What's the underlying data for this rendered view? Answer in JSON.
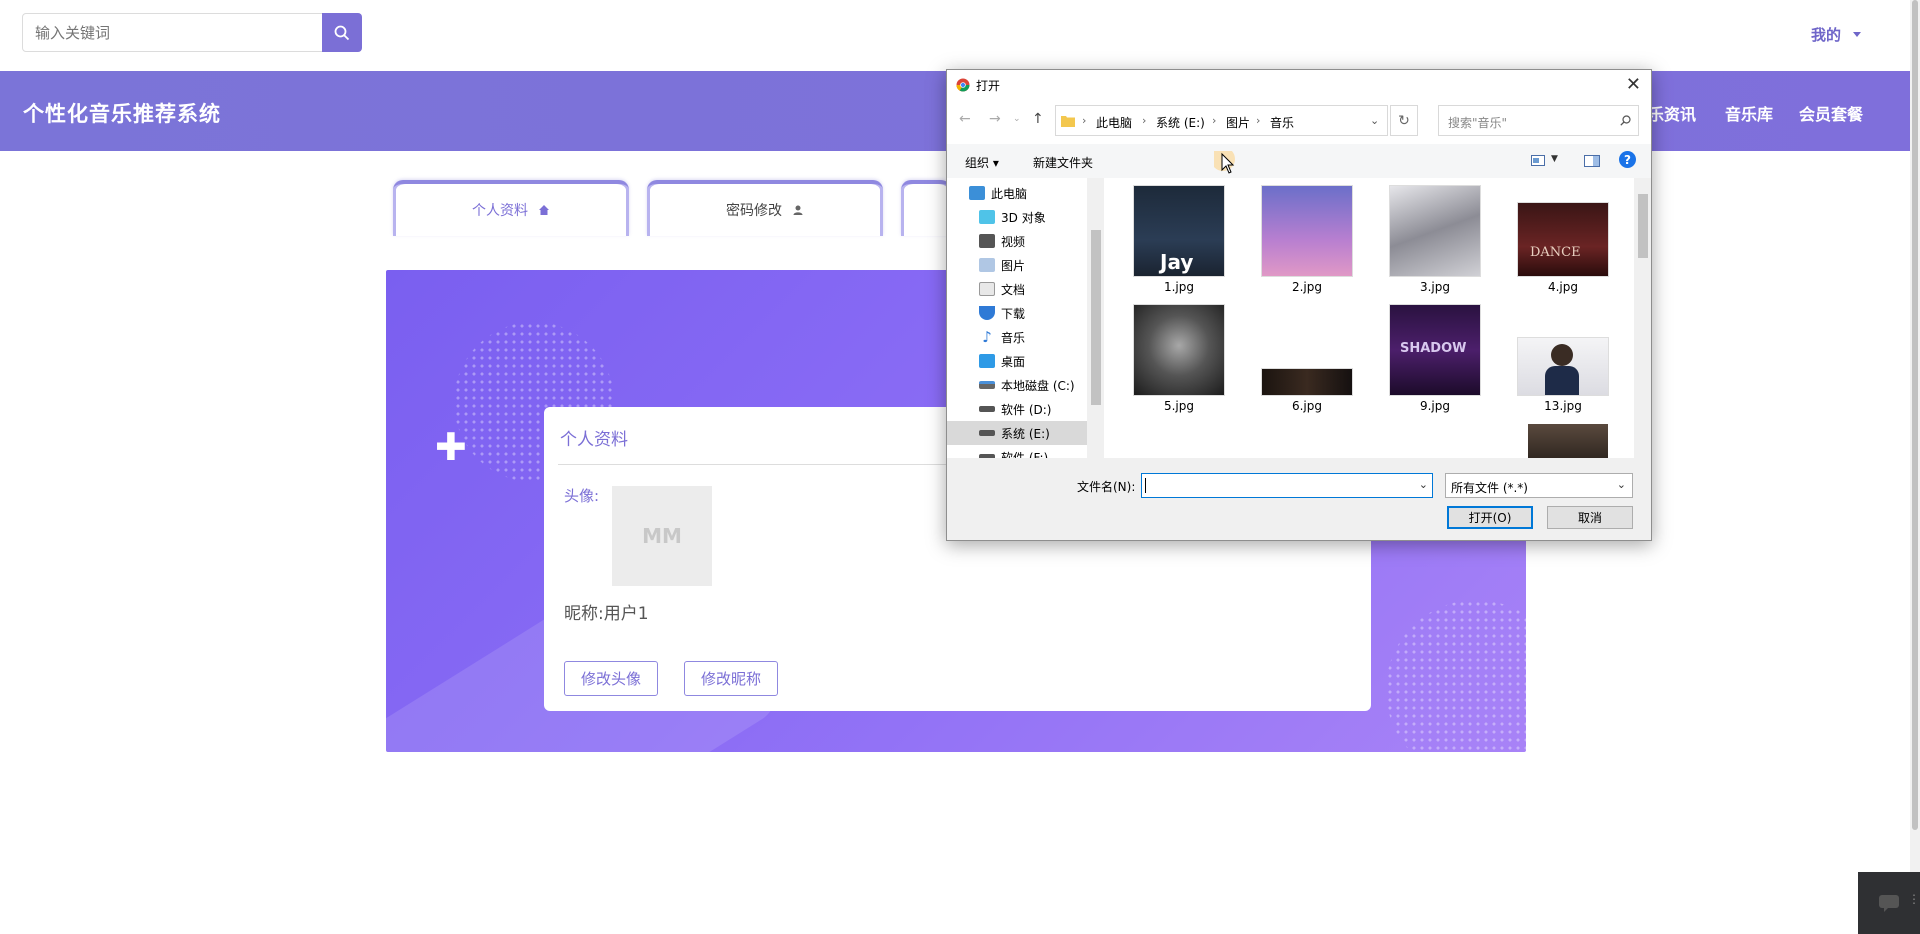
{
  "search": {
    "placeholder": "输入关键词"
  },
  "user_menu": {
    "label": "我的"
  },
  "header": {
    "title": "个性化音乐推荐系统",
    "nav": [
      "乐资讯",
      "音乐库",
      "会员套餐"
    ]
  },
  "tabs": [
    {
      "label": "个人资料",
      "active": true
    },
    {
      "label": "密码修改",
      "active": false
    }
  ],
  "profile": {
    "title": "个人资料",
    "avatar_label": "头像:",
    "avatar_text": "MM",
    "nickname_label": "昵称:",
    "nickname_value": "用户1",
    "buttons": {
      "change_avatar": "修改头像",
      "change_nickname": "修改昵称"
    }
  },
  "dialog": {
    "title": "打开",
    "breadcrumb": [
      "此电脑",
      "系统 (E:)",
      "图片",
      "音乐"
    ],
    "search_placeholder": "搜索\"音乐\"",
    "toolbar": {
      "organize": "组织",
      "new_folder": "新建文件夹"
    },
    "tree": [
      {
        "label": "此电脑",
        "icon": "computer-icon",
        "level": 0,
        "selected": false
      },
      {
        "label": "3D 对象",
        "icon": "3d-objects-icon",
        "level": 1,
        "selected": false
      },
      {
        "label": "视频",
        "icon": "video-icon",
        "level": 1,
        "selected": false
      },
      {
        "label": "图片",
        "icon": "pictures-icon",
        "level": 1,
        "selected": false
      },
      {
        "label": "文档",
        "icon": "documents-icon",
        "level": 1,
        "selected": false
      },
      {
        "label": "下载",
        "icon": "downloads-icon",
        "level": 1,
        "selected": false
      },
      {
        "label": "音乐",
        "icon": "music-icon",
        "level": 1,
        "selected": false
      },
      {
        "label": "桌面",
        "icon": "desktop-icon",
        "level": 1,
        "selected": false
      },
      {
        "label": "本地磁盘 (C:)",
        "icon": "drive-icon",
        "level": 1,
        "selected": false
      },
      {
        "label": "软件 (D:)",
        "icon": "drive-icon",
        "level": 1,
        "selected": false
      },
      {
        "label": "系统 (E:)",
        "icon": "drive-icon",
        "level": 1,
        "selected": true
      },
      {
        "label": "软件 (F:)",
        "icon": "drive-icon",
        "level": 1,
        "selected": false
      }
    ],
    "files": [
      {
        "name": "1.jpg",
        "thumb_text": "Jay"
      },
      {
        "name": "2.jpg",
        "thumb_text": ""
      },
      {
        "name": "3.jpg",
        "thumb_text": ""
      },
      {
        "name": "4.jpg",
        "thumb_text": "DANCE"
      },
      {
        "name": "5.jpg",
        "thumb_text": ""
      },
      {
        "name": "6.jpg",
        "thumb_text": ""
      },
      {
        "name": "9.jpg",
        "thumb_text": "SHADOW"
      },
      {
        "name": "13.jpg",
        "thumb_text": ""
      }
    ],
    "filename_label": "文件名(N):",
    "filename_value": "",
    "filetype": "所有文件 (*.*)",
    "open_button": "打开(O)",
    "cancel_button": "取消"
  },
  "colors": {
    "accent": "#7b6fd6",
    "header_bg": "#7b74d8",
    "banner": "#8a6cf5"
  }
}
